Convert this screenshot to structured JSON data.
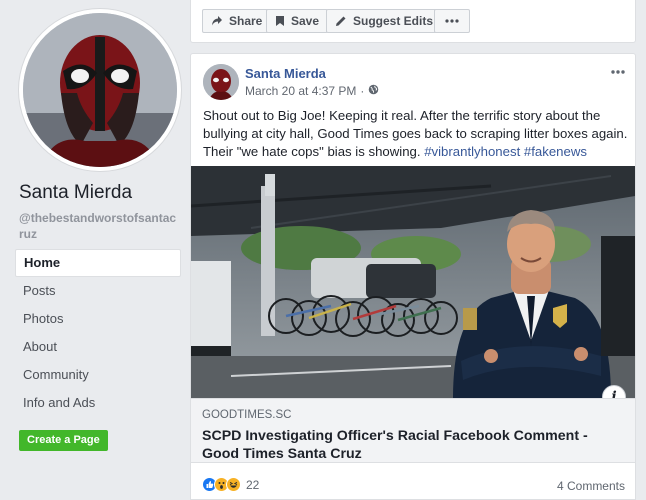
{
  "page": {
    "name": "Santa Mierda",
    "handle": "@thebestandworstofsantacruz"
  },
  "nav": {
    "items": [
      {
        "label": "Home",
        "active": true
      },
      {
        "label": "Posts"
      },
      {
        "label": "Photos"
      },
      {
        "label": "About"
      },
      {
        "label": "Community"
      },
      {
        "label": "Info and Ads"
      }
    ],
    "create_page": "Create a Page"
  },
  "action_bar": {
    "share": "Share",
    "save": "Save",
    "suggest": "Suggest Edits",
    "more_icon": "more-dots-icon"
  },
  "post": {
    "author": "Santa Mierda",
    "timestamp": "March 20 at 4:37 PM",
    "separator": "·",
    "privacy_icon": "globe-icon",
    "text_main": "Shout out to Big Joe! Keeping it real. After the terrific story about the bullying at city hall, Good Times goes back to scraping litter boxes again. Their \"we hate cops\" bias is showing. ",
    "hashtags": [
      "#vibrantlyhonest",
      "#fakenews"
    ],
    "link": {
      "domain": "GOODTIMES.SC",
      "title": "SCPD Investigating Officer's Racial Facebook Comment - Good Times Santa Cruz",
      "info_label": "i"
    },
    "reactions": {
      "types": [
        "like",
        "wow",
        "haha"
      ],
      "count": "22"
    },
    "comments": "4 Comments"
  },
  "colors": {
    "link_blue": "#385898",
    "like_blue": "#1877f2",
    "wow_yellow": "#f7b125",
    "create_green": "#42b72a"
  }
}
